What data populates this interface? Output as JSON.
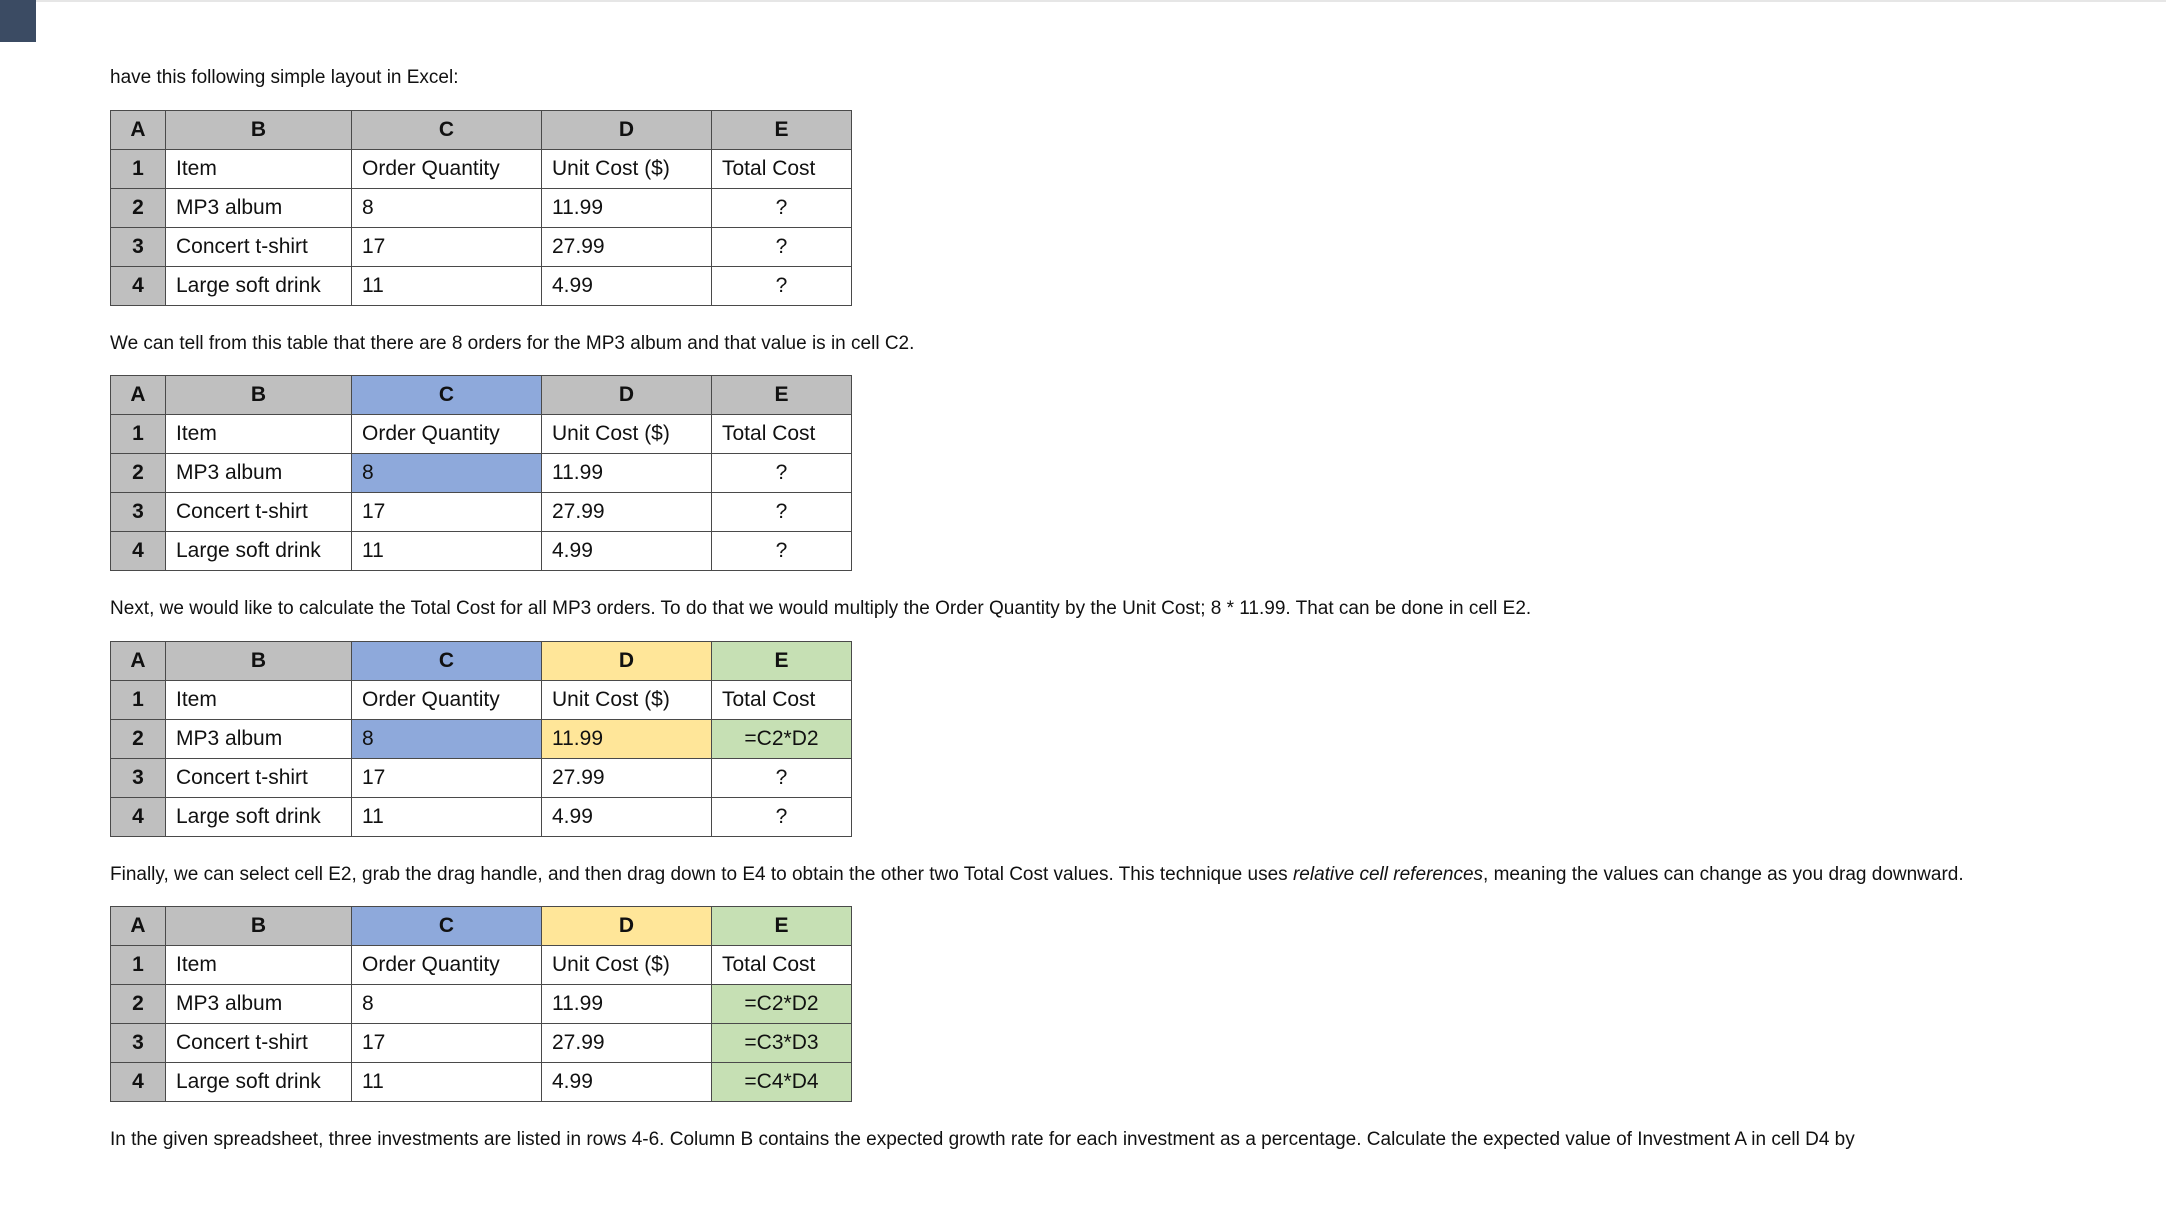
{
  "paragraphs": {
    "intro": "have this following simple layout in Excel:",
    "after_t1": "We can tell from this table that there are 8 orders for the MP3 album and that value is in cell C2.",
    "after_t2": "Next, we would like to calculate the Total Cost for all MP3 orders. To do that we would multiply the Order Quantity by the Unit Cost; 8 * 11.99. That can be done in cell E2.",
    "after_t3_a": "Finally, we can select cell E2, grab the drag handle, and then drag down to E4 to obtain the other two Total Cost values. This technique uses ",
    "after_t3_em": "relative cell references",
    "after_t3_b": ", meaning the values can change as you drag downward.",
    "after_t4": "In the given spreadsheet, three investments are listed in rows 4-6. Column B contains the expected growth rate for each investment as a percentage. Calculate the expected value of Investment A in cell D4 by"
  },
  "columns": [
    "A",
    "B",
    "C",
    "D",
    "E"
  ],
  "chart_data": [
    {
      "type": "table",
      "id": "t1",
      "header_highlight": {},
      "rows": [
        {
          "n": "1",
          "B": "Item",
          "C": "Order Quantity",
          "D": "Unit Cost ($)",
          "E": "Total Cost",
          "hl": {}
        },
        {
          "n": "2",
          "B": "MP3 album",
          "C": "8",
          "D": "11.99",
          "E": "?",
          "hl": {},
          "center_e": true
        },
        {
          "n": "3",
          "B": "Concert t-shirt",
          "C": "17",
          "D": "27.99",
          "E": "?",
          "hl": {},
          "center_e": true
        },
        {
          "n": "4",
          "B": "Large soft drink",
          "C": "11",
          "D": "4.99",
          "E": "?",
          "hl": {},
          "center_e": true
        }
      ]
    },
    {
      "type": "table",
      "id": "t2",
      "header_highlight": {
        "C": "hl-blue"
      },
      "rows": [
        {
          "n": "1",
          "B": "Item",
          "C": "Order Quantity",
          "D": "Unit Cost ($)",
          "E": "Total Cost",
          "hl": {}
        },
        {
          "n": "2",
          "B": "MP3 album",
          "C": "8",
          "D": "11.99",
          "E": "?",
          "hl": {
            "C": "hl-blue"
          },
          "center_e": true
        },
        {
          "n": "3",
          "B": "Concert t-shirt",
          "C": "17",
          "D": "27.99",
          "E": "?",
          "hl": {},
          "center_e": true
        },
        {
          "n": "4",
          "B": "Large soft drink",
          "C": "11",
          "D": "4.99",
          "E": "?",
          "hl": {},
          "center_e": true
        }
      ]
    },
    {
      "type": "table",
      "id": "t3",
      "header_highlight": {
        "C": "hl-blue",
        "D": "hl-yellow",
        "E": "hl-green"
      },
      "rows": [
        {
          "n": "1",
          "B": "Item",
          "C": "Order Quantity",
          "D": "Unit Cost ($)",
          "E": "Total Cost",
          "hl": {}
        },
        {
          "n": "2",
          "B": "MP3 album",
          "C": "8",
          "D": "11.99",
          "E": "=C2*D2",
          "hl": {
            "C": "hl-blue",
            "D": "hl-yellow",
            "E": "hl-green"
          },
          "center_e": true
        },
        {
          "n": "3",
          "B": "Concert t-shirt",
          "C": "17",
          "D": "27.99",
          "E": "?",
          "hl": {},
          "center_e": true
        },
        {
          "n": "4",
          "B": "Large soft drink",
          "C": "11",
          "D": "4.99",
          "E": "?",
          "hl": {},
          "center_e": true
        }
      ]
    },
    {
      "type": "table",
      "id": "t4",
      "header_highlight": {
        "C": "hl-blue",
        "D": "hl-yellow",
        "E": "hl-green"
      },
      "rows": [
        {
          "n": "1",
          "B": "Item",
          "C": "Order Quantity",
          "D": "Unit Cost ($)",
          "E": "Total Cost",
          "hl": {}
        },
        {
          "n": "2",
          "B": "MP3 album",
          "C": "8",
          "D": "11.99",
          "E": "=C2*D2",
          "hl": {
            "E": "hl-green"
          },
          "center_e": true
        },
        {
          "n": "3",
          "B": "Concert t-shirt",
          "C": "17",
          "D": "27.99",
          "E": "=C3*D3",
          "hl": {
            "E": "hl-green"
          },
          "center_e": true
        },
        {
          "n": "4",
          "B": "Large soft drink",
          "C": "11",
          "D": "4.99",
          "E": "=C4*D4",
          "hl": {
            "E": "hl-green"
          },
          "center_e": true
        }
      ]
    }
  ]
}
